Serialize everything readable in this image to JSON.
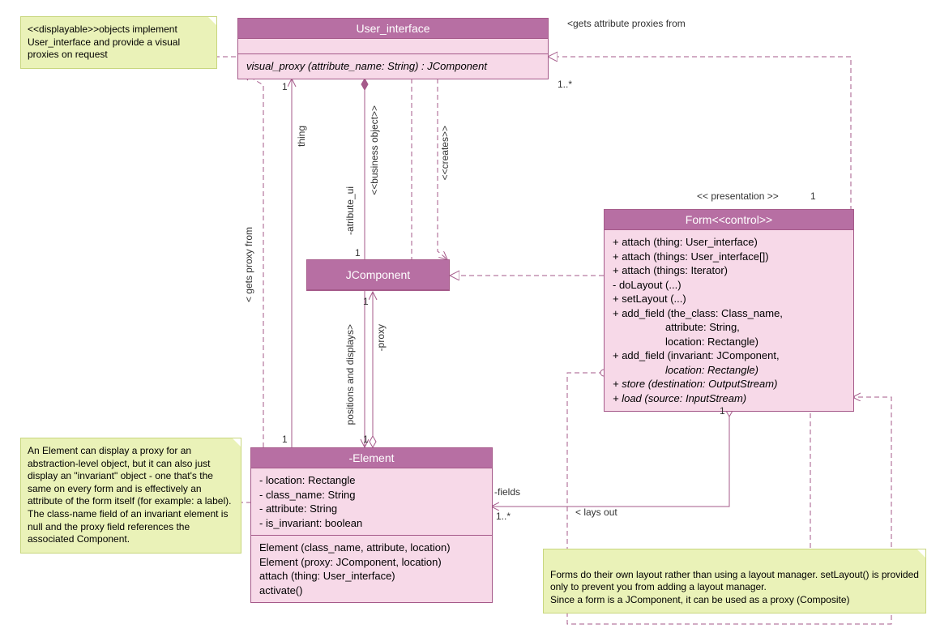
{
  "classes": {
    "user_interface": {
      "title": "User_interface",
      "method": "visual_proxy (attribute_name: String) : JComponent"
    },
    "jcomponent": {
      "title": "JComponent"
    },
    "form": {
      "title": "Form<<control>>",
      "methods": [
        "+ attach (thing: User_interface)",
        "+ attach (things: User_interface[])",
        "+ attach (things: Iterator)",
        "- doLayout (...)",
        "+ setLayout (...)",
        "+ add_field (the_class: Class_name,",
        "                  attribute: String,",
        "                  location: Rectangle)",
        "+ add_field (invariant: JComponent,",
        "                  location: Rectangle)",
        "+ store (destination: OutputStream)",
        "+ load (source: InputStream)"
      ]
    },
    "element": {
      "title": "-Element",
      "attrs": [
        "- location: Rectangle",
        "- class_name: String",
        "- attribute: String",
        "- is_invariant: boolean"
      ],
      "methods": [
        "Element (class_name, attribute, location)",
        "Element (proxy: JComponent, location)",
        "attach (thing: User_interface)",
        "activate()"
      ]
    }
  },
  "notes": {
    "displayable": "<<displayable>>objects implement User_interface and provide a visual proxies on request",
    "element": "An Element can display a proxy for an abstraction-level object, but it can also just display an \"invariant\" object - one that's the same on every form and is effectively an attribute of the form itself (for example: a label). The class-name field of an invariant element is null and the proxy field references the associated Component.",
    "form": "Forms do their own layout rather than using a layout manager. setLayout() is provided only to prevent you from adding a layout manager.\nSince a form is a JComponent, it can be used as a proxy (Composite)"
  },
  "labels": {
    "gets_attr_proxies": "<gets attribute proxies from",
    "presentation": "<< presentation >>",
    "thing": "thing",
    "business_object": "<<business object>>",
    "creates": "<<creates>>",
    "atribute_ui": "-atribute_ui",
    "gets_proxy_from": "< gets proxy from",
    "positions_displays": "positions and displays>",
    "proxy": "-proxy",
    "fields": "-fields",
    "lays_out": "< lays out",
    "m_1": "1",
    "m_1star": "1..*"
  }
}
